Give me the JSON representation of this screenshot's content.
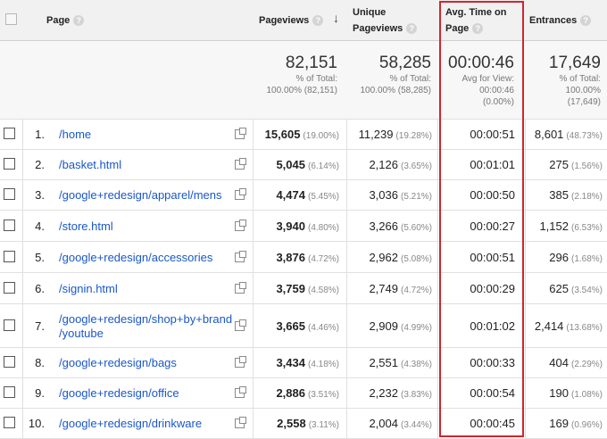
{
  "columns": {
    "page": "Page",
    "pageviews": "Pageviews",
    "unique_line1": "Unique",
    "unique_line2": "Pageviews",
    "avg_line1": "Avg. Time on",
    "avg_line2": "Page",
    "entrances": "Entrances",
    "help_glyph": "?",
    "sort_glyph": "↓"
  },
  "totals": {
    "pageviews": {
      "value": "82,151",
      "line1": "% of Total:",
      "line2": "100.00% (82,151)"
    },
    "unique": {
      "value": "58,285",
      "line1": "% of Total:",
      "line2": "100.00% (58,285)"
    },
    "avg_time": {
      "value": "00:00:46",
      "line1": "Avg for View:",
      "line2": "00:00:46",
      "line3": "(0.00%)"
    },
    "entrances": {
      "value": "17,649",
      "line1": "% of Total:",
      "line2": "100.00%",
      "line3": "(17,649)"
    }
  },
  "rows": [
    {
      "num": "1.",
      "page": "/home",
      "page2": "",
      "pv": "15,605",
      "pv_pct": "(19.00%)",
      "upv": "11,239",
      "upv_pct": "(19.28%)",
      "avg": "00:00:51",
      "ent": "8,601",
      "ent_pct": "(48.73%)"
    },
    {
      "num": "2.",
      "page": "/basket.html",
      "page2": "",
      "pv": "5,045",
      "pv_pct": "(6.14%)",
      "upv": "2,126",
      "upv_pct": "(3.65%)",
      "avg": "00:01:01",
      "ent": "275",
      "ent_pct": "(1.56%)"
    },
    {
      "num": "3.",
      "page": "/google+redesign/apparel/mens",
      "page2": "",
      "pv": "4,474",
      "pv_pct": "(5.45%)",
      "upv": "3,036",
      "upv_pct": "(5.21%)",
      "avg": "00:00:50",
      "ent": "385",
      "ent_pct": "(2.18%)"
    },
    {
      "num": "4.",
      "page": "/store.html",
      "page2": "",
      "pv": "3,940",
      "pv_pct": "(4.80%)",
      "upv": "3,266",
      "upv_pct": "(5.60%)",
      "avg": "00:00:27",
      "ent": "1,152",
      "ent_pct": "(6.53%)"
    },
    {
      "num": "5.",
      "page": "/google+redesign/accessories",
      "page2": "",
      "pv": "3,876",
      "pv_pct": "(4.72%)",
      "upv": "2,962",
      "upv_pct": "(5.08%)",
      "avg": "00:00:51",
      "ent": "296",
      "ent_pct": "(1.68%)"
    },
    {
      "num": "6.",
      "page": "/signin.html",
      "page2": "",
      "pv": "3,759",
      "pv_pct": "(4.58%)",
      "upv": "2,749",
      "upv_pct": "(4.72%)",
      "avg": "00:00:29",
      "ent": "625",
      "ent_pct": "(3.54%)"
    },
    {
      "num": "7.",
      "page": "/google+redesign/shop+by+brand",
      "page2": "/youtube",
      "pv": "3,665",
      "pv_pct": "(4.46%)",
      "upv": "2,909",
      "upv_pct": "(4.99%)",
      "avg": "00:01:02",
      "ent": "2,414",
      "ent_pct": "(13.68%)"
    },
    {
      "num": "8.",
      "page": "/google+redesign/bags",
      "page2": "",
      "pv": "3,434",
      "pv_pct": "(4.18%)",
      "upv": "2,551",
      "upv_pct": "(4.38%)",
      "avg": "00:00:33",
      "ent": "404",
      "ent_pct": "(2.29%)"
    },
    {
      "num": "9.",
      "page": "/google+redesign/office",
      "page2": "",
      "pv": "2,886",
      "pv_pct": "(3.51%)",
      "upv": "2,232",
      "upv_pct": "(3.83%)",
      "avg": "00:00:54",
      "ent": "190",
      "ent_pct": "(1.08%)"
    },
    {
      "num": "10.",
      "page": "/google+redesign/drinkware",
      "page2": "",
      "pv": "2,558",
      "pv_pct": "(3.11%)",
      "upv": "2,004",
      "upv_pct": "(3.44%)",
      "avg": "00:00:45",
      "ent": "169",
      "ent_pct": "(0.96%)"
    }
  ],
  "highlight": {
    "column": "avg_time",
    "color": "#d0262e"
  }
}
